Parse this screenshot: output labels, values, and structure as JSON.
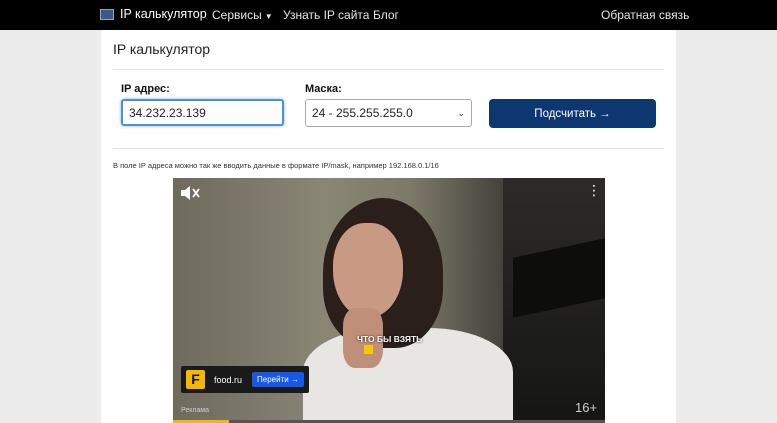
{
  "navbar": {
    "brand": "IP калькулятор",
    "services": "Сервисы",
    "find_ip": "Узнать IP сайта",
    "blog": "Блог",
    "feedback": "Обратная связь"
  },
  "page": {
    "title": "IP калькулятор"
  },
  "form": {
    "ip_label": "IP адрес:",
    "ip_value": "34.232.23.139",
    "mask_label": "Маска:",
    "mask_value": "24 - 255.255.255.0",
    "submit_label": "Подсчитать →"
  },
  "hint": "В поле IP адреса можно так же вводить данные в формате IP/mask, например 192.168.0.1/16",
  "video_ad": {
    "caption": "ЧТО БЫ ВЗЯТЬ",
    "advertiser": "food.ru",
    "advertiser_logo": "F",
    "cta": "Перейти →",
    "ad_label": "Реклама",
    "age_rating": "16+",
    "progress_fraction": 0.13
  },
  "colors": {
    "navbar_bg": "#000000",
    "button_bg": "#0d3770",
    "input_focus": "#4a8fe0",
    "ad_accent": "#f5b800",
    "cta_bg": "#1858e8"
  }
}
